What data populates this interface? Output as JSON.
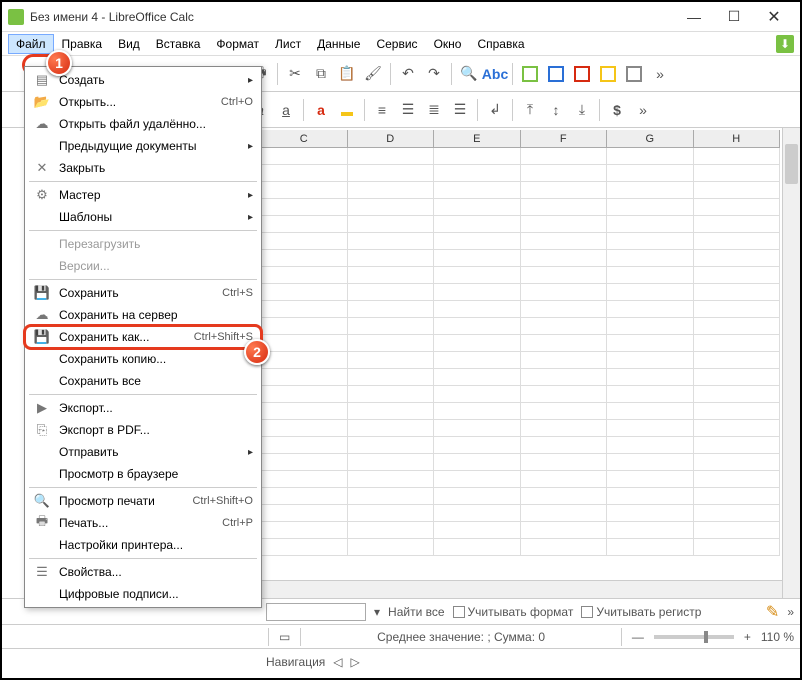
{
  "title": "Без имени 4 - LibreOffice Calc",
  "menubar": [
    "Файл",
    "Правка",
    "Вид",
    "Вставка",
    "Формат",
    "Лист",
    "Данные",
    "Сервис",
    "Окно",
    "Справка"
  ],
  "file_menu": [
    {
      "icon": "new",
      "label": "Создать",
      "shortcut": "",
      "sub": true
    },
    {
      "icon": "open",
      "label": "Открыть...",
      "shortcut": "Ctrl+O"
    },
    {
      "icon": "open-remote",
      "label": "Открыть файл удалённо..."
    },
    {
      "label": "Предыдущие документы",
      "sub": true
    },
    {
      "icon": "close",
      "label": "Закрыть"
    },
    {
      "sep": true
    },
    {
      "icon": "wizard",
      "label": "Мастер",
      "sub": true
    },
    {
      "label": "Шаблоны",
      "sub": true
    },
    {
      "sep": true
    },
    {
      "label": "Перезагрузить",
      "disabled": true
    },
    {
      "label": "Версии...",
      "disabled": true
    },
    {
      "sep": true
    },
    {
      "icon": "save",
      "label": "Сохранить",
      "shortcut": "Ctrl+S"
    },
    {
      "icon": "save-remote",
      "label": "Сохранить на сервер"
    },
    {
      "icon": "save-as",
      "label": "Сохранить как...",
      "shortcut": "Ctrl+Shift+S",
      "highlight": true
    },
    {
      "label": "Сохранить копию..."
    },
    {
      "label": "Сохранить все"
    },
    {
      "sep": true
    },
    {
      "icon": "export",
      "label": "Экспорт..."
    },
    {
      "icon": "pdf",
      "label": "Экспорт в PDF..."
    },
    {
      "label": "Отправить",
      "sub": true
    },
    {
      "label": "Просмотр в браузере"
    },
    {
      "sep": true
    },
    {
      "icon": "preview",
      "label": "Просмотр печати",
      "shortcut": "Ctrl+Shift+O"
    },
    {
      "icon": "print",
      "label": "Печать...",
      "shortcut": "Ctrl+P"
    },
    {
      "label": "Настройки принтера..."
    },
    {
      "sep": true
    },
    {
      "icon": "props",
      "label": "Свойства..."
    },
    {
      "label": "Цифровые подписи..."
    }
  ],
  "columns": [
    "C",
    "D",
    "E",
    "F",
    "G",
    "H"
  ],
  "findbar": {
    "find_all": "Найти все",
    "match_format": "Учитывать формат",
    "match_case": "Учитывать регистр"
  },
  "statusbar": {
    "summary": "Среднее значение: ; Сумма: 0",
    "zoom": "110 %"
  },
  "nav": "Навигация",
  "callouts": {
    "c1": "1",
    "c2": "2"
  }
}
